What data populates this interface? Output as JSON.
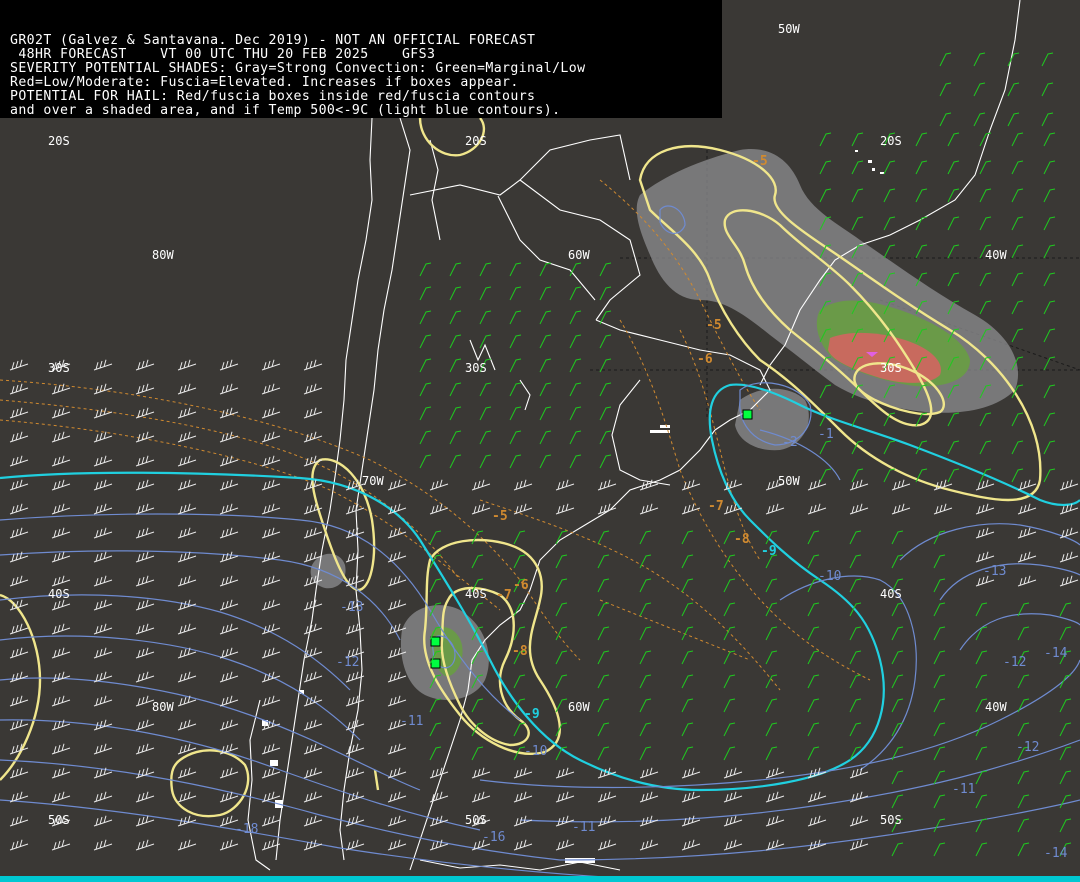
{
  "header": {
    "lines": [
      "GR02T (Galvez & Santavana. Dec 2019) - NOT AN OFFICIAL FORECAST",
      " 48HR FORECAST    VT 00 UTC THU 20 FEB 2025    GFS3",
      "SEVERITY POTENTIAL SHADES: Gray=Strong Convection: Green=Marginal/Low",
      "Red=Low/Moderate: Fuscia=Elevated. Increases if boxes appear.",
      "POTENTIAL FOR HAIL: Red/fuscia boxes inside red/fuscia contours",
      "and over a shaded area, and if Temp 500<-9C (light blue contours)."
    ]
  },
  "grid_labels": {
    "lon_50w_top": "50W",
    "lat_20s_left": "20S",
    "lat_20s_mid": "20S",
    "lat_20s_right": "20S",
    "lon_80w_upper": "80W",
    "lon_60w_upper": "60W",
    "lon_40w_upper": "40W",
    "lat_30s_left": "30S",
    "lat_30s_mid": "30S",
    "lat_30s_right": "30S",
    "lon_70w_mid": "70W",
    "lon_50w_mid": "50W",
    "lat_40s_left": "40S",
    "lat_40s_mid": "40S",
    "lat_40s_right": "40S",
    "lon_80w_lower": "80W",
    "lon_60w_lower": "60W",
    "lon_40w_lower": "40W",
    "lat_50s_left": "50S",
    "lat_50s_mid": "50S",
    "lat_50s_right": "50S"
  },
  "contour_labels": {
    "orange": [
      "-5",
      "-5",
      "-6",
      "-5",
      "-7",
      "-6",
      "-7",
      "-8",
      "-8"
    ],
    "cyan": [
      "-9",
      "-9"
    ],
    "blue": [
      "-10",
      "-11",
      "-12",
      "-13",
      "-14",
      "-13",
      "-12",
      "-11",
      "-10",
      "-11",
      "-14",
      "-16",
      "-18",
      "-12",
      "-1",
      "-2"
    ]
  },
  "colors": {
    "background": "#3a3835",
    "header_bg": "#000000",
    "coastline": "#ffffff",
    "severity_gray": "#8a8a8d",
    "severity_green": "#6a9a48",
    "severity_red": "#c86a5e",
    "severity_fuscia": "#e060e0",
    "hail_box": "#00ff40",
    "temp_500_cyan": "#20d0e0",
    "temp_500_blue": "#6f8bd0",
    "dashed_orange": "#d08a30",
    "yellow_contour": "#f0e68c",
    "wind_barb_green": "#20c820",
    "wind_barb_white": "#e8e8e8"
  }
}
